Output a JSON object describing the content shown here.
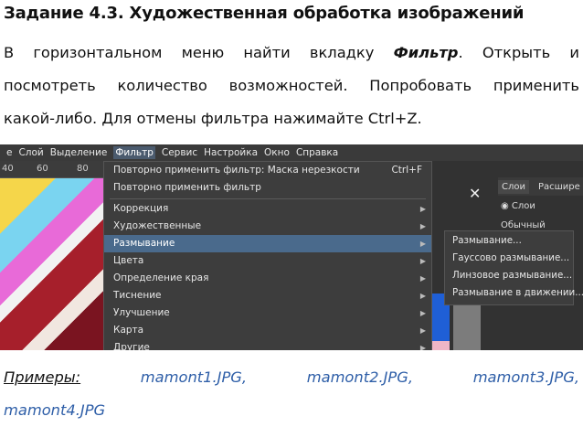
{
  "title": "Задание 4.3. Художественная обработка изображений",
  "paragraph": {
    "line1_a": "В горизонтальном меню найти вкладку ",
    "line1_bold": "Фильтр",
    "line1_b": ". Открыть и",
    "line2": "посмотреть количество возможностей. Попробовать применить",
    "line3": "какой-либо. Для отмены фильтра нажимайте Ctrl+Z."
  },
  "screenshot": {
    "menubar": [
      "е",
      "Слой",
      "Выделение",
      "Фильтр",
      "Сервис",
      "Настройка",
      "Окно",
      "Справка"
    ],
    "ruler_ticks": [
      "40",
      "60",
      "80"
    ],
    "filter_menu": {
      "repeat_with": "Повторно применить фильтр: Маска нерезкости",
      "repeat_shortcut": "Ctrl+F",
      "repeat": "Повторно применить фильтр",
      "items": [
        "Коррекция",
        "Художественные",
        "Размывание",
        "Цвета",
        "Определение края",
        "Тиснение",
        "Улучшение",
        "Карта",
        "Другие"
      ],
      "highlighted_index": 2
    },
    "blur_submenu": [
      "Размывание...",
      "Гауссово размывание...",
      "Линзовое размывание...",
      "Размывание в движении..."
    ],
    "right_panel": {
      "tabs": [
        "Слои",
        "Расшире"
      ],
      "layers_label": "Слои",
      "blend_mode": "Обычный"
    },
    "close_symbol": "✕"
  },
  "examples": {
    "label": "Примеры:",
    "files": [
      "mamont1.JPG,",
      "mamont2.JPG,",
      "mamont3.JPG,",
      "mamont4.JPG"
    ]
  },
  "colors": {
    "menu_bg": "#3d3d3d",
    "menu_highlight": "#4a6a8c",
    "link_blue": "#2f5fa8"
  }
}
